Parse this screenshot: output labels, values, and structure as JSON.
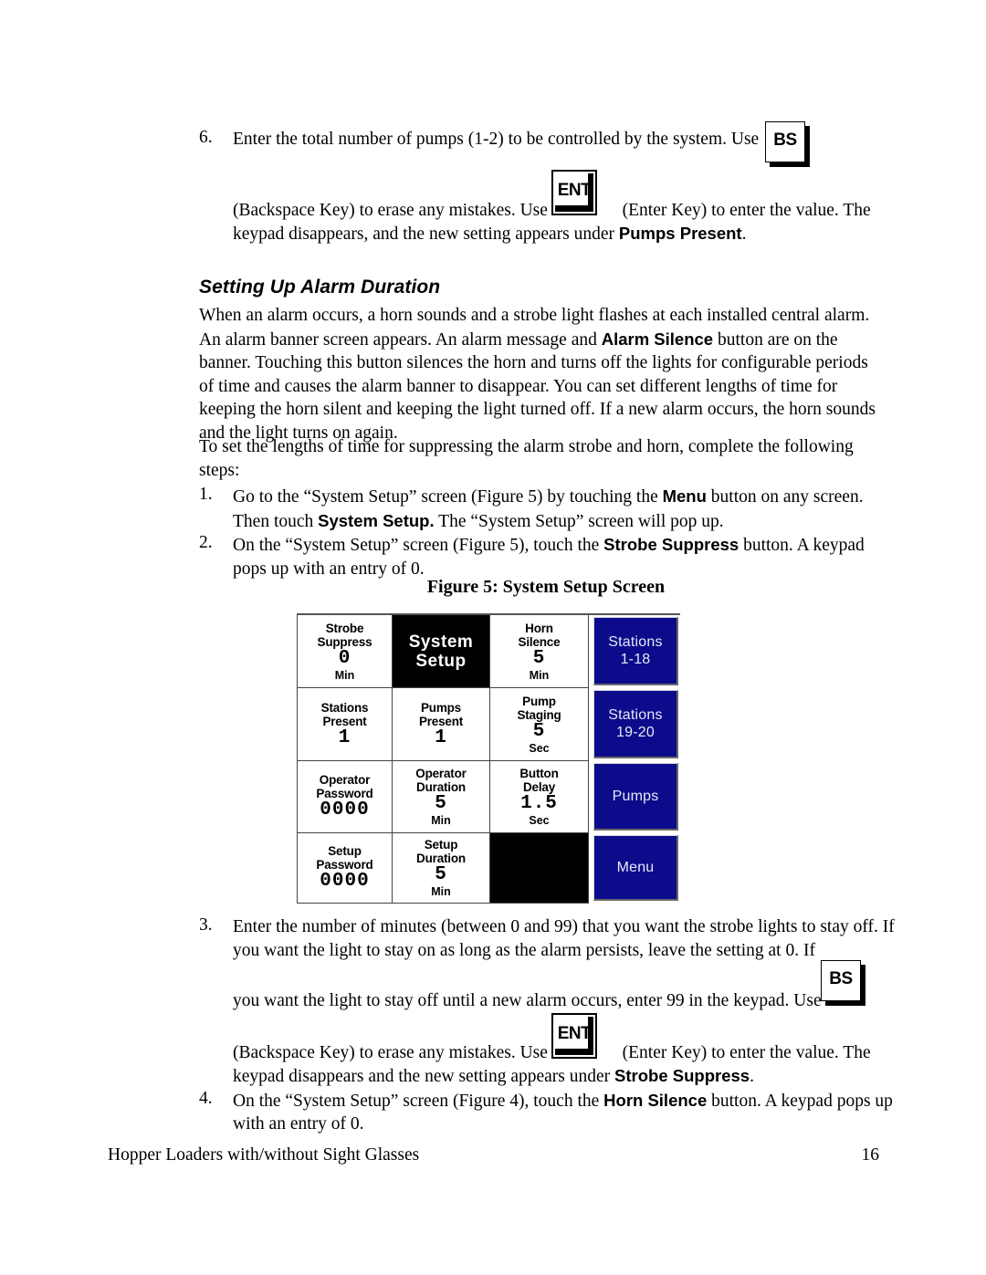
{
  "document": {
    "step6": {
      "number": "6.",
      "line1_a": "Enter the total number of pumps (1-2) to be controlled by the system.  Use",
      "line2_a": "(Backspace Key) to erase any mistakes.  Use",
      "line2_b": "(Enter Key)  to enter the value.  The",
      "line3_a": "keypad disappears, and the new setting appears under ",
      "line3_bold": "Pumps Present",
      "line3_b": "."
    },
    "section": {
      "heading": "Setting Up Alarm Duration",
      "intro_a": "When an alarm occurs, a horn sounds and a strobe light flashes at each installed central alarm. An alarm banner screen appears.  An alarm message and ",
      "intro_bold": "Alarm Silence",
      "intro_b": " button are on the banner.  Touching this button silences the horn and turns off the lights for configurable periods of time and causes the alarm banner to disappear.  You can set different lengths of time for keeping the horn silent and keeping the light turned off.  If a new alarm occurs, the horn sounds and the light turns on again.",
      "lead_in": "To set the lengths of time for suppressing the alarm strobe and horn, complete the following steps:"
    },
    "steps": [
      {
        "number": "1.",
        "part_a": "Go to the “System Setup” screen (Figure 5) by touching the ",
        "bold_1": "Menu",
        "part_b": " button on any screen. Then touch ",
        "bold_2": "System Setup.",
        "part_c": "  The “System Setup” screen will pop up."
      },
      {
        "number": "2.",
        "part_a": "On the “System Setup” screen (Figure 5), touch the ",
        "bold_1": "Strobe Suppress",
        "part_b": " button. A keypad pops up with an entry of 0."
      }
    ],
    "step3": {
      "number": "3.",
      "line1": "Enter the number of minutes (between 0 and 99) that you want the strobe lights to stay off.  If you want the light to stay on as long as the alarm persists, leave the setting at 0.  If",
      "line2": "you want the light to stay off until a new alarm occurs, enter 99 in the keypad. Use",
      "line3_a": "(Backspace Key) to erase any mistakes.  Use",
      "line3_b": "(Enter Key) to enter the value.  The",
      "line4_a": "keypad disappears and the new setting appears under ",
      "line4_bold": "Strobe Suppress",
      "line4_b": "."
    },
    "step4": {
      "number": "4.",
      "part_a": "On the “System Setup” screen (Figure 4), touch the ",
      "bold_1": "Horn Silence",
      "part_b": " button.  A keypad pops up with an entry of 0."
    },
    "keys": {
      "backspace": "BS",
      "enter": "ENT"
    },
    "figure": {
      "caption": "Figure 5: System Setup Screen",
      "accent_navy": "#0b0b8b",
      "rows": [
        {
          "cells": [
            {
              "kind": "value",
              "label_1": "Strobe",
              "label_2": "Suppress",
              "value": "0",
              "unit": "Min"
            },
            {
              "kind": "title",
              "title_1": "System",
              "title_2": "Setup"
            },
            {
              "kind": "value",
              "label_1": "Horn",
              "label_2": "Silence",
              "value": "5",
              "unit": "Min"
            },
            {
              "kind": "button",
              "btn_1": "Stations",
              "btn_2": "1-18"
            }
          ]
        },
        {
          "cells": [
            {
              "kind": "value",
              "label_1": "Stations",
              "label_2": "Present",
              "value": "1",
              "unit": ""
            },
            {
              "kind": "value",
              "label_1": "Pumps",
              "label_2": "Present",
              "value": "1",
              "unit": ""
            },
            {
              "kind": "value",
              "label_1": "Pump",
              "label_2": "Staging",
              "value": "5",
              "unit": "Sec"
            },
            {
              "kind": "button",
              "btn_1": "Stations",
              "btn_2": "19-20"
            }
          ]
        },
        {
          "cells": [
            {
              "kind": "value",
              "label_1": "Operator",
              "label_2": "Password",
              "value": "0000",
              "unit": ""
            },
            {
              "kind": "value",
              "label_1": "Operator",
              "label_2": "Duration",
              "value": "5",
              "unit": "Min"
            },
            {
              "kind": "value",
              "label_1": "Button",
              "label_2": "Delay",
              "value": "1.5",
              "unit": "Sec"
            },
            {
              "kind": "button",
              "btn_1": "Pumps",
              "btn_2": ""
            }
          ]
        },
        {
          "cells": [
            {
              "kind": "value",
              "label_1": "Setup",
              "label_2": "Password",
              "value": "0000",
              "unit": ""
            },
            {
              "kind": "value",
              "label_1": "Setup",
              "label_2": "Duration",
              "value": "5",
              "unit": "Min"
            },
            {
              "kind": "blank",
              "label_1": "",
              "label_2": "",
              "value": "",
              "unit": ""
            },
            {
              "kind": "button",
              "btn_1": "Menu",
              "btn_2": ""
            }
          ]
        }
      ]
    },
    "footer": {
      "title": "Hopper Loaders with/without Sight Glasses",
      "page_number": "16"
    }
  }
}
